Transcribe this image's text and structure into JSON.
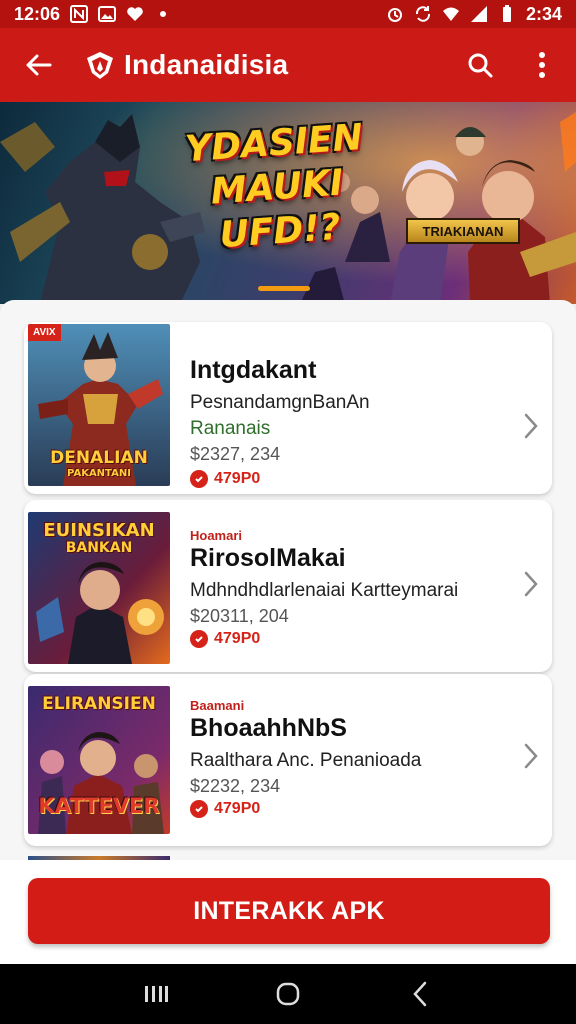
{
  "status_bar": {
    "time_left": "12:06",
    "time_right": "2:34",
    "icons_left": [
      "n-icon",
      "image-icon",
      "heart-icon",
      "dot-icon"
    ],
    "icons_right": [
      "alarm-icon",
      "sync-icon",
      "wifi-icon",
      "signal-icon",
      "battery-icon"
    ]
  },
  "app_bar": {
    "title": "Indanaidisia",
    "icons": [
      "back-arrow-icon",
      "brand-logo",
      "search-icon",
      "overflow-menu-icon"
    ]
  },
  "banner": {
    "headline_lines": [
      "YDASIEN",
      "MAUKI",
      "UFD!?"
    ],
    "tag_label": "TRIAKIANAN"
  },
  "apps": [
    {
      "badge": "AVIX",
      "kicker": "",
      "name": "Intgdakant",
      "developer": "PesnandamgnBanAn",
      "category": "Rananais",
      "meta": "$2327, 234",
      "rating": "479P0",
      "thumb_title": "DENALIAN",
      "thumb_subtitle": "PAKANTANI"
    },
    {
      "badge": "",
      "kicker": "Hoamari",
      "name": "RirosolMakai",
      "developer": "Mdhndhdlarlenaiai Kartteymarai",
      "category": "",
      "meta": "$20311, 204",
      "rating": "479P0",
      "thumb_title": "EUINSIKAN",
      "thumb_subtitle": "BANKAN"
    },
    {
      "badge": "",
      "kicker": "Baamani",
      "name": "BhoaahhNbS",
      "developer": "Raalthara Anc. Penanioada",
      "category": "",
      "meta": "$2232, 234",
      "rating": "479P0",
      "thumb_title": "ELIRANSIEN",
      "thumb_subtitle": "KATTEVER"
    }
  ],
  "cta": {
    "label": "INTERAKK APK"
  },
  "nav_bar": {
    "icons": [
      "recents-icon",
      "home-icon",
      "back-icon"
    ]
  },
  "colors": {
    "primary": "#cc1b16",
    "status_bar": "#b3120f",
    "cta": "#d31c16",
    "rating": "#d6231a",
    "category": "#2f6f2b"
  }
}
